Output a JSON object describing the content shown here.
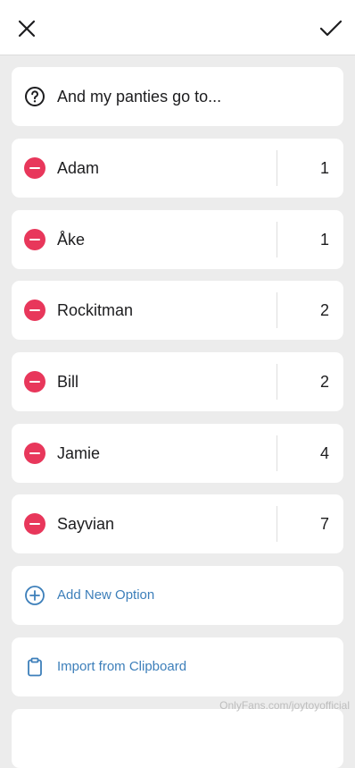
{
  "header": {
    "close_icon": "close-icon",
    "confirm_icon": "checkmark-icon"
  },
  "question": {
    "icon": "help-circle-icon",
    "text": "And my panties go to..."
  },
  "options": [
    {
      "name": "Adam",
      "votes": "1"
    },
    {
      "name": "Åke",
      "votes": "1"
    },
    {
      "name": "Rockitman",
      "votes": "2"
    },
    {
      "name": "Bill",
      "votes": "2"
    },
    {
      "name": "Jamie",
      "votes": "4"
    },
    {
      "name": "Sayvian",
      "votes": "7"
    }
  ],
  "actions": {
    "add_option": {
      "label": "Add New Option",
      "icon": "plus-circle-icon"
    },
    "import_clipboard": {
      "label": "Import from Clipboard",
      "icon": "clipboard-icon"
    }
  },
  "colors": {
    "remove": "#e8375b",
    "accent": "#3d7fba",
    "background": "#ececec"
  },
  "watermark": "OnlyFans.com/joytoyofficial"
}
